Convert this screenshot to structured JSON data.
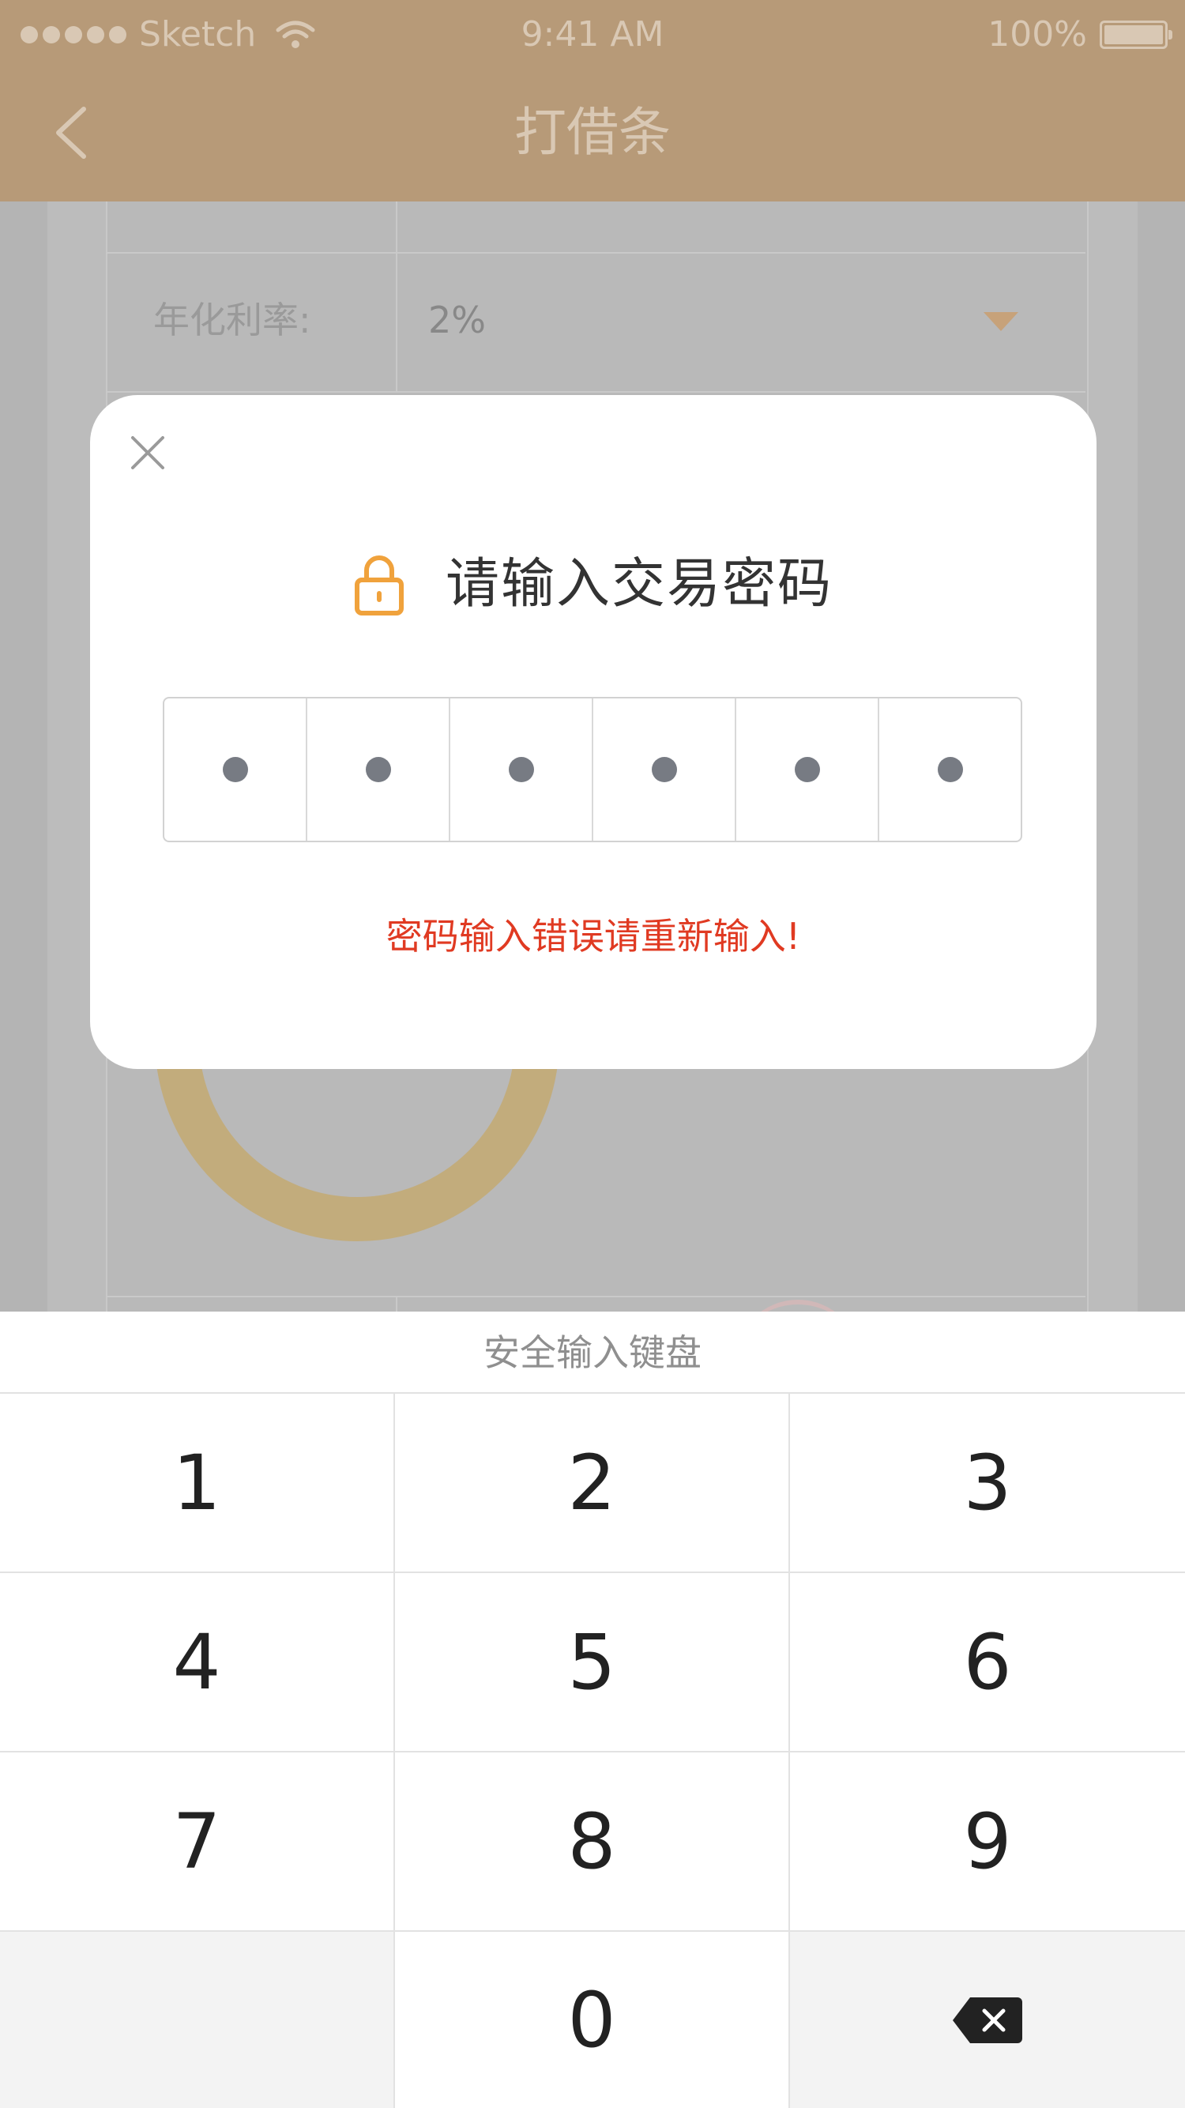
{
  "status_bar": {
    "carrier": "Sketch",
    "time": "9:41 AM",
    "battery": "100%"
  },
  "nav": {
    "title": "打借条",
    "back_icon": "chevron-left-icon"
  },
  "background_form": {
    "rate_label": "年化利率:",
    "rate_value": "2%",
    "dropdown_icon": "triangle-down-icon"
  },
  "password_dialog": {
    "close_icon": "close-icon",
    "lock_icon": "lock-icon",
    "title": "请输入交易密码",
    "pin_length": 6,
    "pin_filled": 6,
    "error": "密码输入错误请重新输入!"
  },
  "keyboard": {
    "title": "安全输入键盘",
    "keys": [
      "1",
      "2",
      "3",
      "4",
      "5",
      "6",
      "7",
      "8",
      "9",
      "",
      "0",
      "delete"
    ],
    "delete_icon": "backspace-icon"
  },
  "colors": {
    "nav_bar": "#b79a78",
    "accent_orange": "#f0a23c",
    "error_red": "#e03a22",
    "dim_overlay": "#b4b4b4"
  }
}
